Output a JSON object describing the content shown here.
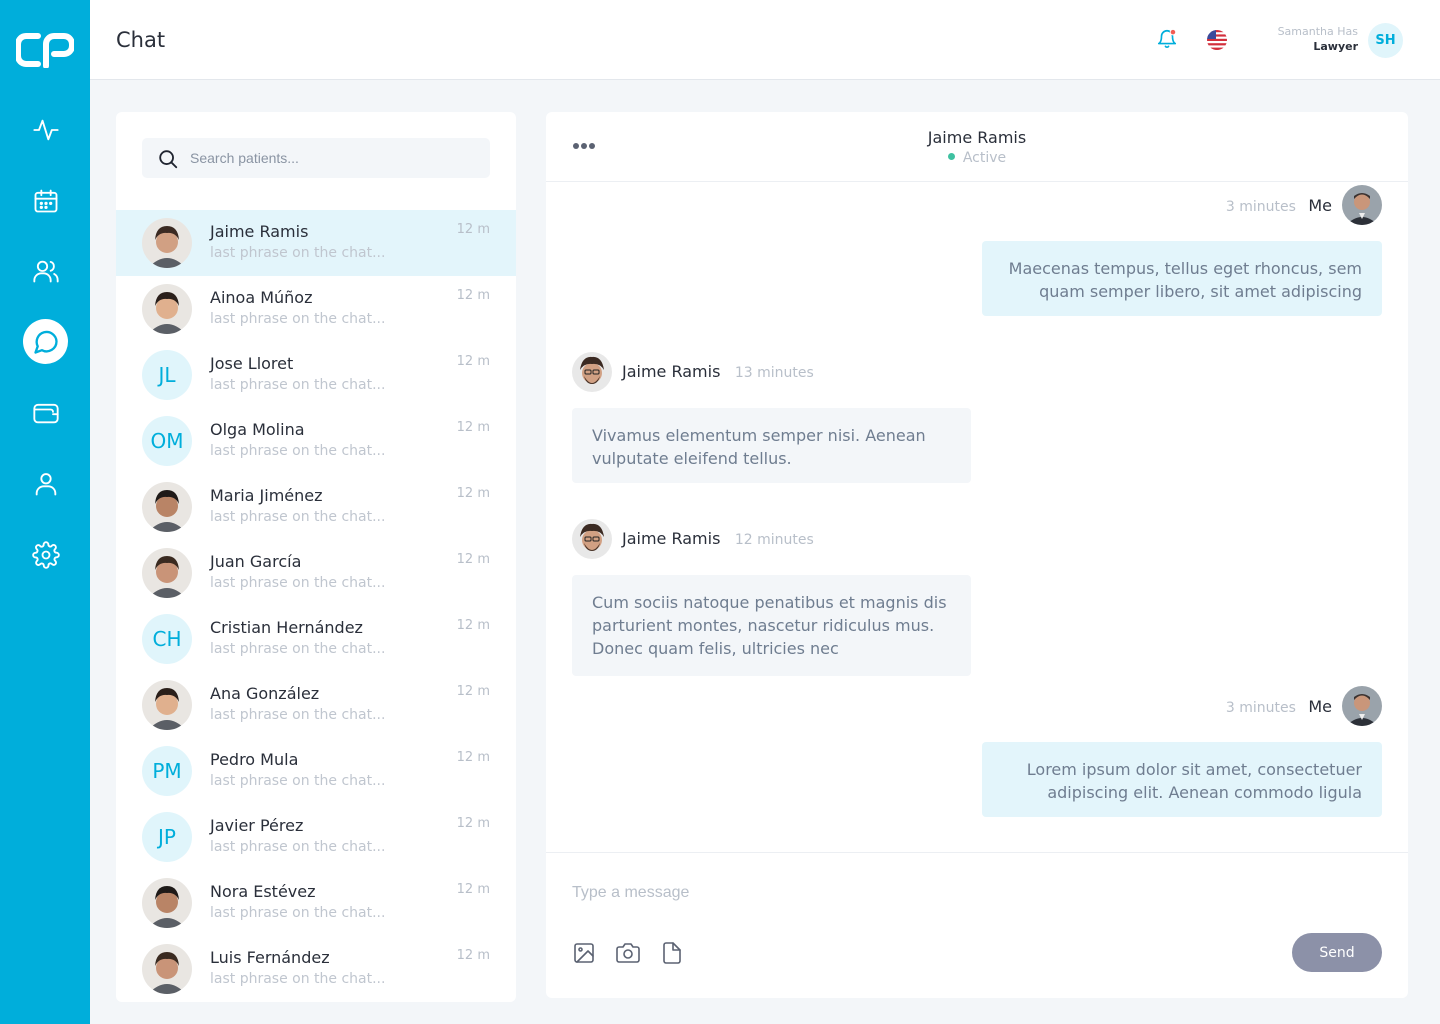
{
  "header": {
    "title": "Chat",
    "user": {
      "name": "Samantha Has",
      "role": "Lawyer",
      "initials": "SH"
    }
  },
  "sidebar": {
    "items": [
      {
        "icon": "activity-icon"
      },
      {
        "icon": "calendar-icon"
      },
      {
        "icon": "users-icon"
      },
      {
        "icon": "chat-icon",
        "active": true
      },
      {
        "icon": "wallet-icon"
      },
      {
        "icon": "user-icon"
      },
      {
        "icon": "gear-icon"
      }
    ]
  },
  "search": {
    "placeholder": "Search patients..."
  },
  "contacts": [
    {
      "name": "Jaime Ramis",
      "preview": "last phrase on the chat...",
      "time": "12 m",
      "avatar": "photo",
      "selected": true
    },
    {
      "name": "Ainoa Múñoz",
      "preview": "last phrase on the chat...",
      "time": "12 m",
      "avatar": "photo"
    },
    {
      "name": "Jose Lloret",
      "preview": "last phrase on the chat...",
      "time": "12 m",
      "initials": "JL"
    },
    {
      "name": "Olga Molina",
      "preview": "last phrase on the chat...",
      "time": "12 m",
      "initials": "OM"
    },
    {
      "name": "Maria Jiménez",
      "preview": "last phrase on the chat...",
      "time": "12 m",
      "avatar": "photo"
    },
    {
      "name": "Juan García",
      "preview": "last phrase on the chat...",
      "time": "12 m",
      "avatar": "photo"
    },
    {
      "name": "Cristian Hernández",
      "preview": "last phrase on the chat...",
      "time": "12 m",
      "initials": "CH"
    },
    {
      "name": "Ana González",
      "preview": "last phrase on the chat...",
      "time": "12 m",
      "avatar": "photo"
    },
    {
      "name": "Pedro Mula",
      "preview": "last phrase on the chat...",
      "time": "12 m",
      "initials": "PM"
    },
    {
      "name": "Javier Pérez",
      "preview": "last phrase on the chat...",
      "time": "12 m",
      "initials": "JP"
    },
    {
      "name": "Nora Estévez",
      "preview": "last phrase on the chat...",
      "time": "12 m",
      "avatar": "photo"
    },
    {
      "name": "Luis Fernández",
      "preview": "last phrase on the chat...",
      "time": "12 m",
      "avatar": "photo"
    }
  ],
  "chat": {
    "contact_name": "Jaime Ramis",
    "status": "Active",
    "messages": [
      {
        "from": "me",
        "sender": "Me",
        "time": "3 minutes",
        "text": "Maecenas tempus, tellus eget rhoncus, sem quam semper libero, sit amet adipiscing"
      },
      {
        "from": "them",
        "sender": "Jaime Ramis",
        "time": "13 minutes",
        "text": "Vivamus elementum semper nisi. Aenean vulputate eleifend tellus."
      },
      {
        "from": "them",
        "sender": "Jaime Ramis",
        "time": "12 minutes",
        "text": "Cum sociis natoque penatibus et magnis dis parturient montes, nascetur ridiculus mus. Donec quam felis, ultricies nec"
      },
      {
        "from": "me",
        "sender": "Me",
        "time": "3 minutes",
        "text": "Lorem ipsum dolor sit amet, consectetuer adipiscing elit. Aenean commodo ligula"
      }
    ],
    "composer": {
      "placeholder": "Type a message",
      "send_label": "Send"
    }
  },
  "colors": {
    "brand": "#00aedb",
    "selected_row": "#e3f5fb",
    "send_button": "#8c91a8",
    "active_dot": "#3fc1a1"
  }
}
